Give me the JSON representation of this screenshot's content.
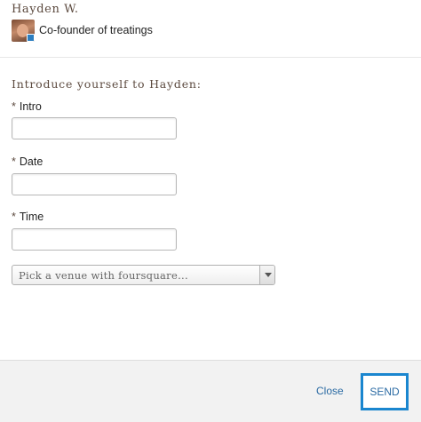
{
  "header": {
    "name": "Hayden W.",
    "title": "Co-founder of treatings",
    "avatar_icon": "user-photo"
  },
  "form": {
    "heading": "Introduce yourself to Hayden:",
    "required_marker": "*",
    "fields": [
      {
        "label": "Intro",
        "value": "",
        "placeholder": ""
      },
      {
        "label": "Date",
        "value": "",
        "placeholder": ""
      },
      {
        "label": "Time",
        "value": "",
        "placeholder": ""
      }
    ],
    "venue_select": {
      "selected": "Pick a venue with foursquare...",
      "icon": "chevron-down-icon"
    }
  },
  "footer": {
    "close_label": "Close",
    "send_label": "SEND",
    "accent_color": "#1a86cf",
    "link_color": "#2a6aa3"
  }
}
